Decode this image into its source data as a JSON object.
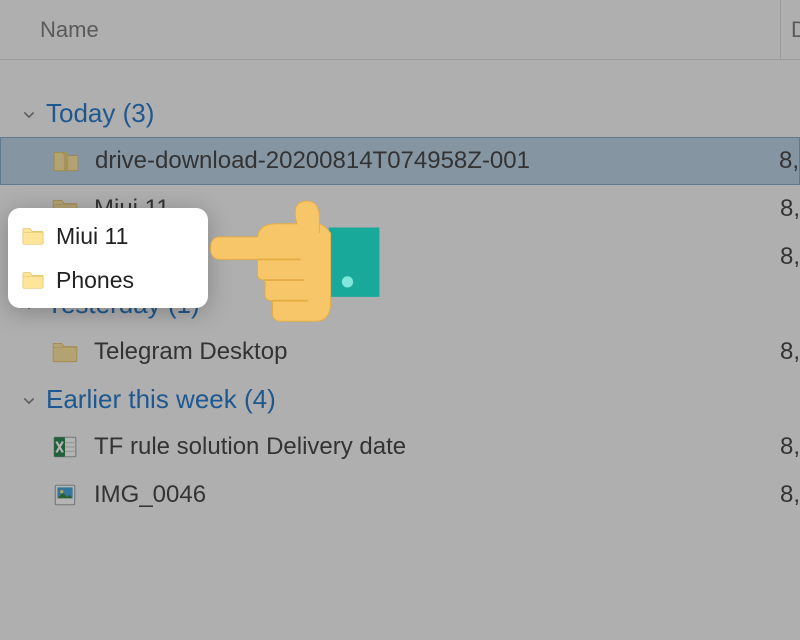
{
  "header": {
    "name_label": "Name",
    "date_label_stub": "D"
  },
  "groups": [
    {
      "label": "Today (3)",
      "items": [
        {
          "kind": "zip",
          "name": "drive-download-20200814T074958Z-001",
          "date_stub": "8,",
          "selected": true
        },
        {
          "kind": "folder",
          "name": "Miui 11",
          "date_stub": "8,"
        },
        {
          "kind": "folder",
          "name": "Phones",
          "date_stub": "8,"
        }
      ]
    },
    {
      "label": "Yesterday (1)",
      "items": [
        {
          "kind": "folder",
          "name": "Telegram Desktop",
          "date_stub": "8,"
        }
      ]
    },
    {
      "label": "Earlier this week (4)",
      "items": [
        {
          "kind": "excel",
          "name": "TF rule solution Delivery date",
          "date_stub": "8,"
        },
        {
          "kind": "image",
          "name": "IMG_0046",
          "date_stub": "8,"
        }
      ]
    }
  ],
  "popover": {
    "items": [
      {
        "label": "Miui 11"
      },
      {
        "label": "Phones"
      }
    ]
  }
}
